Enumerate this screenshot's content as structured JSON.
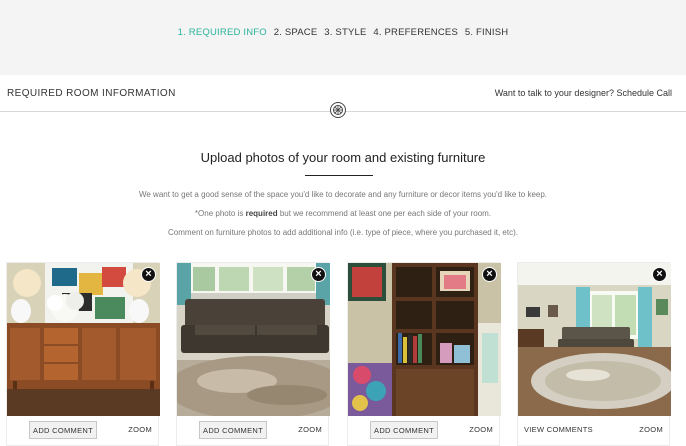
{
  "steps": [
    {
      "label": "1. REQUIRED INFO",
      "active": true
    },
    {
      "label": "2. SPACE",
      "active": false
    },
    {
      "label": "3. STYLE",
      "active": false
    },
    {
      "label": "4. PREFERENCES",
      "active": false
    },
    {
      "label": "5. FINISH",
      "active": false
    }
  ],
  "header": {
    "title": "REQUIRED ROOM INFORMATION",
    "designer_link": "Want to talk to your designer? Schedule Call"
  },
  "upload": {
    "title": "Upload photos of your room and existing furniture",
    "line1": "We want to get a good sense of the space you'd like to decorate and any furniture or decor items you'd like to keep.",
    "line2_prefix": "*One photo is ",
    "line2_bold": "required",
    "line2_suffix": " but we recommend at least one per each side of your room.",
    "line3": "Comment on furniture photos to add additional info (i.e. type of piece, where you purchased it, etc)."
  },
  "photos": [
    {
      "subject": "sideboard-photo",
      "action_label": "ADD COMMENT",
      "action_type": "button",
      "zoom_label": "ZOOM",
      "close_icon": "close-icon"
    },
    {
      "subject": "sofa-photo",
      "action_label": "ADD COMMENT",
      "action_type": "button",
      "zoom_label": "ZOOM",
      "close_icon": "close-icon"
    },
    {
      "subject": "bookshelf-photo",
      "action_label": "ADD COMMENT",
      "action_type": "button",
      "zoom_label": "ZOOM",
      "close_icon": "close-icon"
    },
    {
      "subject": "living-room-photo",
      "action_label": "VIEW COMMENTS",
      "action_type": "link",
      "zoom_label": "ZOOM",
      "close_icon": "close-icon"
    }
  ],
  "colors": {
    "accent": "#2bb39a",
    "steps_background": "#f4f4f4"
  }
}
